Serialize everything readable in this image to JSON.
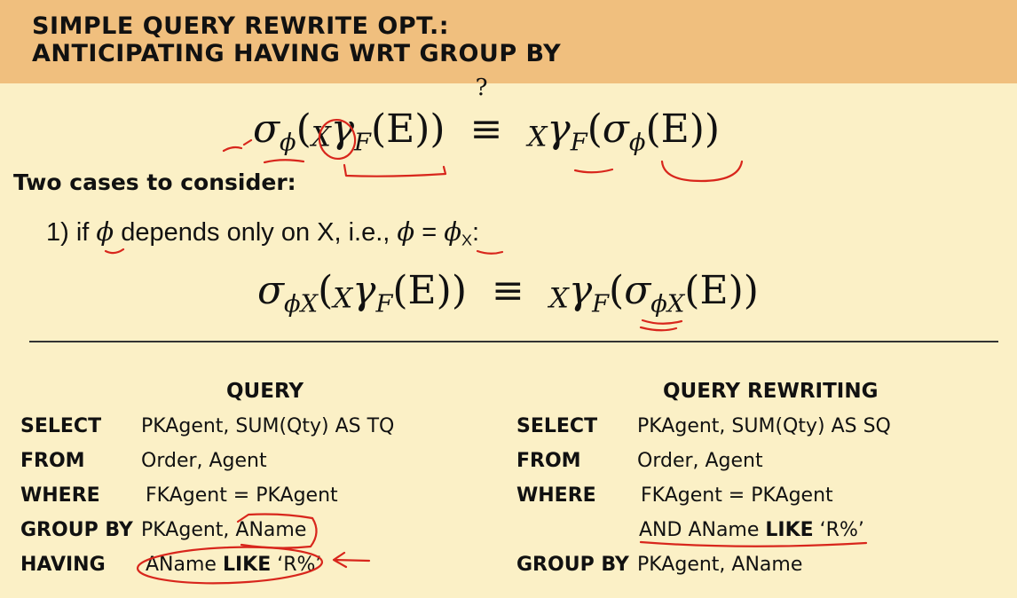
{
  "title": {
    "line1": "SIMPLE QUERY REWRITE OPT.:",
    "line2": "ANTICIPATING HAVING WRT GROUP BY"
  },
  "formula1": {
    "sigma": "σ",
    "phi": "ϕ",
    "open": "(",
    "x": "X",
    "gamma": "γ",
    "f": "F",
    "arg": "(E))",
    "eq": "≡",
    "eq_mark": "?",
    "rhs_x": "X",
    "rhs_gamma": "γ",
    "rhs_f": "F",
    "rhs_open": "(",
    "rhs_sigma": "σ",
    "rhs_phi": "ϕ",
    "rhs_arg": "(E))"
  },
  "cases_heading": "Two cases to consider:",
  "case1": {
    "prefix": "1) if ",
    "phi": "ϕ",
    "middle": " depends only on X, i.e., ",
    "phi2": "ϕ",
    "equals": " = ",
    "phi3": "ϕ",
    "sub": "X",
    "colon": ":"
  },
  "formula2": {
    "sigma": "σ",
    "phi": "ϕ",
    "phi_sub": "X",
    "open": "(",
    "x": "X",
    "gamma": "γ",
    "f": "F",
    "arg": "(E))",
    "eq": "≡",
    "rhs_x": "X",
    "rhs_gamma": "γ",
    "rhs_f": "F",
    "rhs_open": "(",
    "rhs_sigma": "σ",
    "rhs_phi": "ϕ",
    "rhs_phi_sub": "X",
    "rhs_arg": "(E))"
  },
  "query": {
    "heading": "QUERY",
    "select_kw": "SELECT",
    "select_val": "PKAgent, SUM(Qty) AS TQ",
    "from_kw": "FROM",
    "from_val": "Order, Agent",
    "where_kw": "WHERE",
    "where_val": "FKAgent = PKAgent",
    "groupby_kw": "GROUP BY",
    "groupby_val": "PKAgent, AName",
    "having_kw": "HAVING",
    "having_pre": "AName ",
    "having_like": "LIKE",
    "having_post": " ‘R%’"
  },
  "rewrite": {
    "heading": "QUERY REWRITING",
    "select_kw": "SELECT",
    "select_val": "PKAgent, SUM(Qty) AS SQ",
    "from_kw": "FROM",
    "from_val": "Order, Agent",
    "where_kw": "WHERE",
    "where_val": "FKAgent = PKAgent",
    "and_pre": "AND AName ",
    "and_like": "LIKE",
    "and_post": " ‘R%’",
    "groupby_kw": "GROUP BY",
    "groupby_val": "PKAgent, AName"
  },
  "colors": {
    "header_bg": "#f0bf7e",
    "page_bg": "#fbf0c6",
    "annotation": "#d8261c"
  }
}
